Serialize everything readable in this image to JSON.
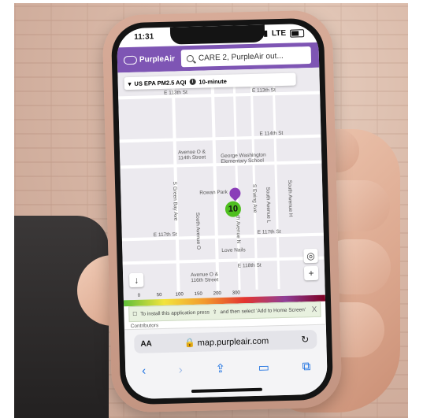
{
  "status": {
    "time": "11:31",
    "network": "LTE"
  },
  "app": {
    "logo_text": "PurpleAir",
    "search_text": "CARE 2, PurpleAir out...",
    "aqi_label": "US EPA PM2.5 AQI",
    "interval": "10-minute"
  },
  "map": {
    "labels": {
      "e113": "E 113th St",
      "e114": "E 114th St",
      "e117a": "E 117th St",
      "e117b": "E 117th St",
      "e118": "E 118th St",
      "ave_o_114": "Avenue O &\n114th Street",
      "ave_o_116": "Avenue O &\n116th Street",
      "school": "George Washington\nElementary School",
      "park": "Rowan Park",
      "love_nails": "Love Nails",
      "green_bay": "S Green Bay Ave",
      "ave_o": "South Avenue O",
      "ave_n": "South Avenue N",
      "ave_l": "South Avenue L",
      "ave_h": "South Avenue H",
      "ewing": "S Ewing Ave"
    },
    "sensor_value": "10",
    "scale_ticks": [
      "0",
      "50",
      "100",
      "150",
      "200",
      "300"
    ],
    "colors": {
      "good": "#5fbf3a",
      "moderate": "#f2e43d",
      "usg": "#f29a2e",
      "unhealthy": "#e3342f",
      "very_unhealthy": "#8f3f97",
      "hazardous": "#7e0023"
    }
  },
  "banner": {
    "text_a": "To install this application press",
    "text_b": "and then select 'Add to Home Screen'",
    "close": "X"
  },
  "contributors": "Contributors",
  "safari": {
    "aa": "AA",
    "url": "map.purpleair.com",
    "reload": "↻",
    "toolbar_icons": [
      "back-icon",
      "forward-icon",
      "share-icon",
      "bookmarks-icon",
      "tabs-icon"
    ]
  },
  "theme": {
    "brand": "#7e55b4",
    "link": "#1a6fe0"
  }
}
